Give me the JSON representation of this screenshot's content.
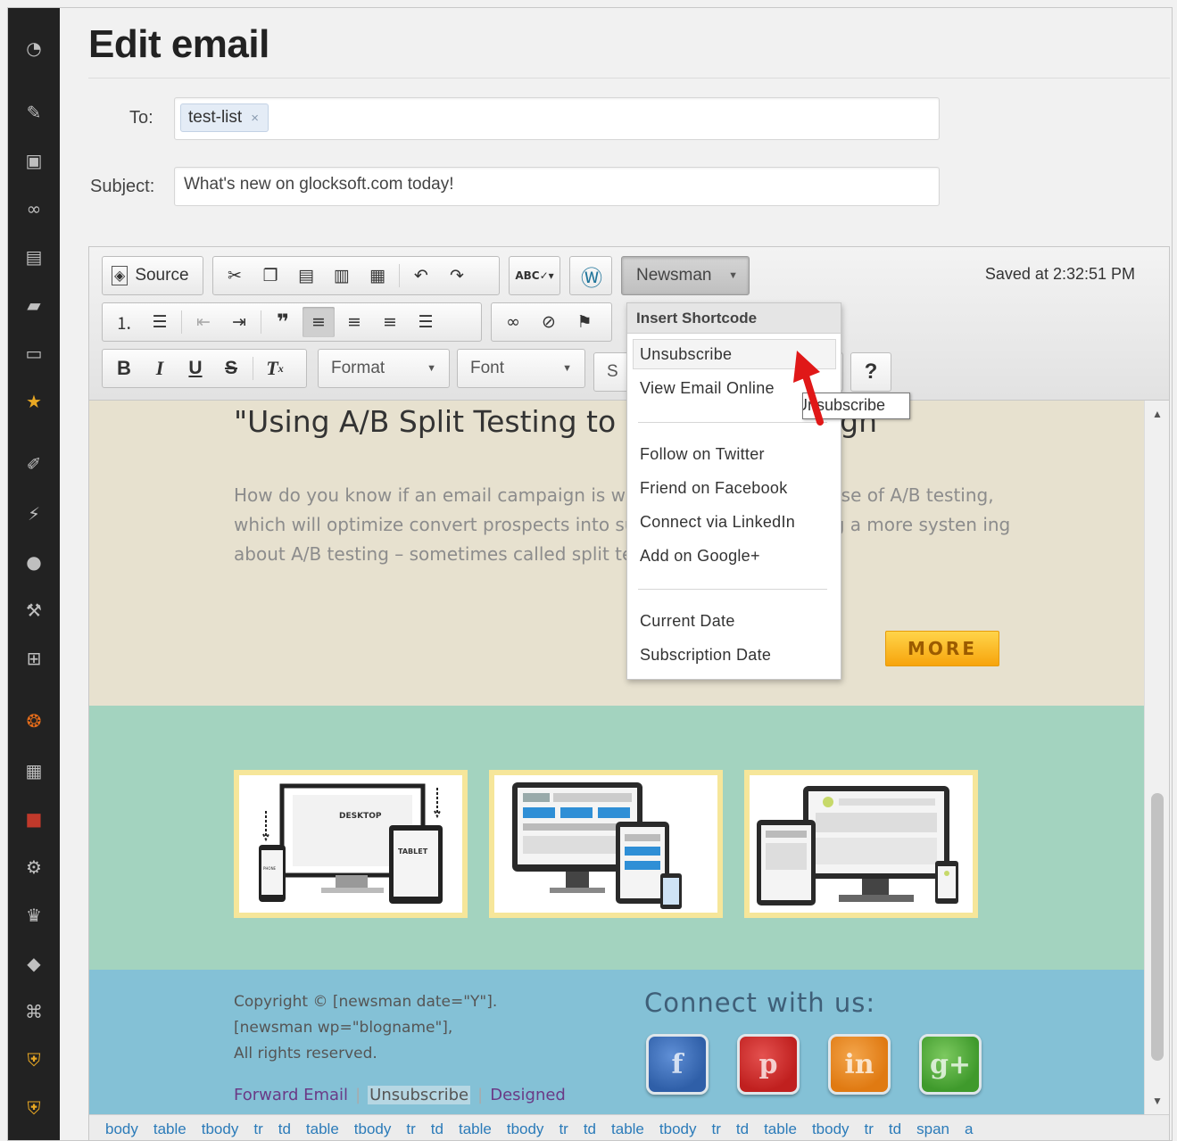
{
  "page": {
    "title": "Edit email"
  },
  "sidebar": {
    "icons": [
      "dashboard-icon",
      "pin-icon",
      "media-icon",
      "links-icon",
      "pages-icon",
      "comments-icon",
      "feedback-icon",
      "star-icon",
      "appearance-icon",
      "plugins-icon",
      "users-icon",
      "tools-icon",
      "settings-icon",
      "newsman-icon",
      "forms-icon",
      "wp-icon",
      "gear-icon",
      "crown-icon",
      "box-icon",
      "command-icon",
      "shield-icon",
      "shield-icon-2"
    ]
  },
  "form": {
    "to_label": "To:",
    "to_tag": "test-list",
    "tag_remove": "×",
    "subject_label": "Subject:",
    "subject_value": "What's new on glocksoft.com today!"
  },
  "toolbar": {
    "source_label": "Source",
    "format_label": "Format",
    "font_label": "Font",
    "style_label": "S",
    "newsman_label": "Newsman",
    "help_label": "?",
    "saved_text": "Saved at 2:32:51 PM",
    "spell_label": "ABC"
  },
  "menu": {
    "header": "Insert Shortcode",
    "items": [
      "Unsubscribe",
      "View Email Online",
      "Follow on Twitter",
      "Friend on Facebook",
      "Connect via LinkedIn",
      "Add on Google+",
      "Current Date",
      "Subscription Date"
    ],
    "tooltip": "Unsubscribe"
  },
  "content": {
    "article_title": "\"Using A/B Split Testing to C                                                mail Campaign\"",
    "article_body": "How do you know if an email campaign is wo                                         program that makes use of A/B testing, which will optimize                                           convert prospects into subscribers by employing a more systen                                        ing about A/B testing – sometimes called split testing – the",
    "more_label": "MORE",
    "thumb_labels": {
      "desktop": "DESKTOP",
      "tablet": "TABLET",
      "phone": "PHONE"
    },
    "copyright_lines": [
      "Copyright © [newsman date=\"Y\"].",
      "[newsman wp=\"blogname\"],",
      "All rights reserved."
    ],
    "footer_links": [
      "Forward Email",
      "Unsubscribe",
      "Designed"
    ],
    "footer_sep": "|",
    "connect_label": "Connect with us:",
    "social": [
      {
        "name": "facebook",
        "glyph": "f",
        "color": "#2f5fa8"
      },
      {
        "name": "pinterest",
        "glyph": "p",
        "color": "#c0201f"
      },
      {
        "name": "linkedin",
        "glyph": "in",
        "color": "#e07a12"
      },
      {
        "name": "googleplus",
        "glyph": "g+",
        "color": "#3f9a2c"
      }
    ]
  },
  "pathbar": [
    "body",
    "table",
    "tbody",
    "tr",
    "td",
    "table",
    "tbody",
    "tr",
    "td",
    "table",
    "tbody",
    "tr",
    "td",
    "table",
    "tbody",
    "tr",
    "td",
    "table",
    "tbody",
    "tr",
    "td",
    "span",
    "a"
  ],
  "colors": {
    "beige": "#e7e1cf",
    "green": "#a3d3bf",
    "blue": "#84c1d6",
    "more": "#f7a40c",
    "link": "#2b7bb9"
  }
}
